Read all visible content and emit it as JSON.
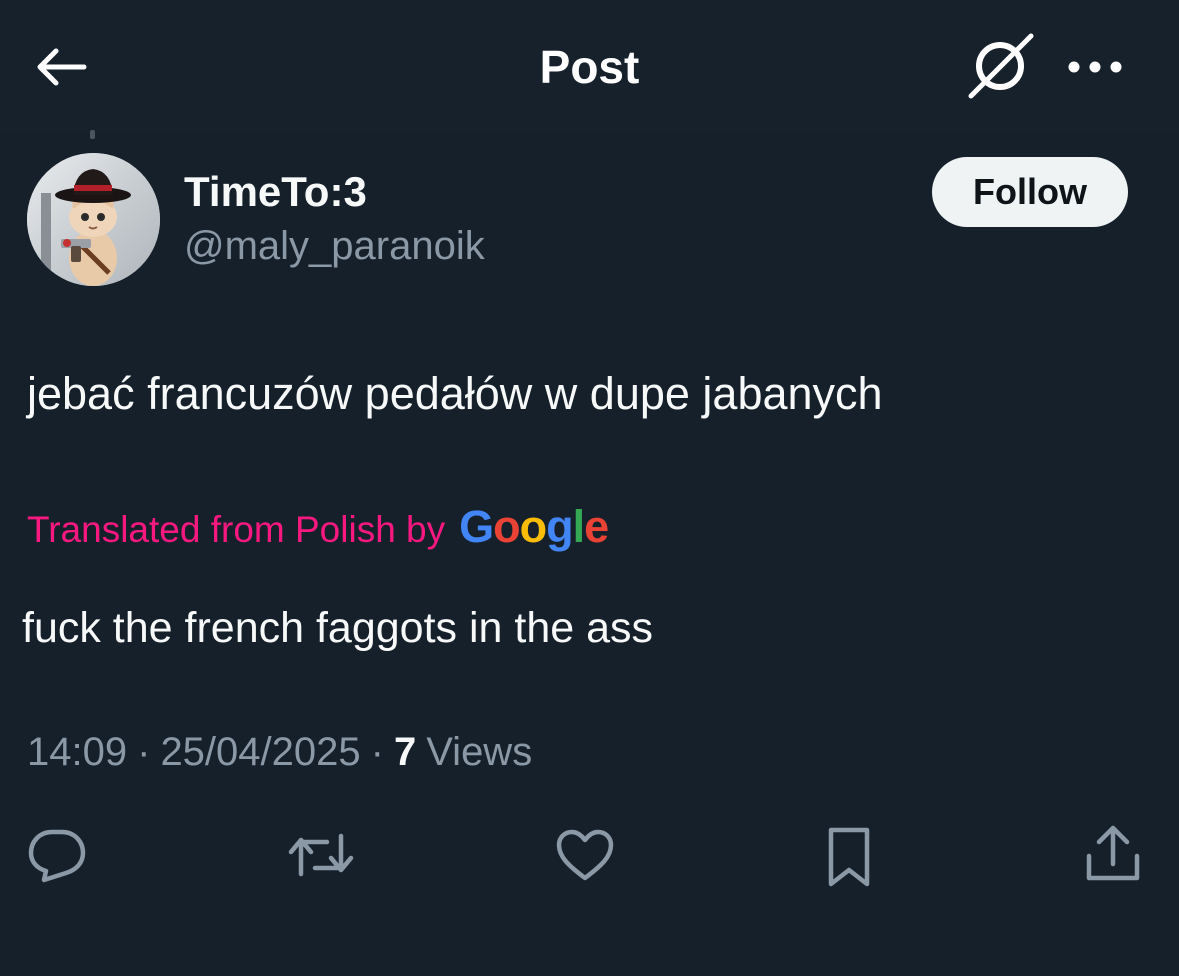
{
  "header": {
    "title": "Post"
  },
  "author": {
    "display_name": "TimeTo:3",
    "handle": "@maly_paranoik",
    "follow_label": "Follow"
  },
  "post": {
    "text": "jebać francuzów pedałów w dupe jabanych",
    "translated_label": "Translated from Polish by",
    "translation_provider": "Google",
    "translation": "fuck the french faggots in the ass",
    "time": "14:09",
    "date": "25/04/2025",
    "views_count": "7",
    "views_label": "Views",
    "separator": "·"
  },
  "icons": {
    "back": "arrow-left-icon",
    "grok": "grok-icon",
    "more": "more-horizontal-icon",
    "reply": "reply-icon",
    "repost": "repost-icon",
    "like": "heart-icon",
    "bookmark": "bookmark-icon",
    "share": "share-icon"
  },
  "colors": {
    "background": "#15202b",
    "text": "#f7f9f9",
    "secondary_text": "#8b98a5",
    "translation_accent": "#f91880",
    "follow_button_bg": "#eff3f4",
    "google_blue": "#4285f4",
    "google_red": "#ea4335",
    "google_yellow": "#fbbc05",
    "google_green": "#34a853"
  }
}
